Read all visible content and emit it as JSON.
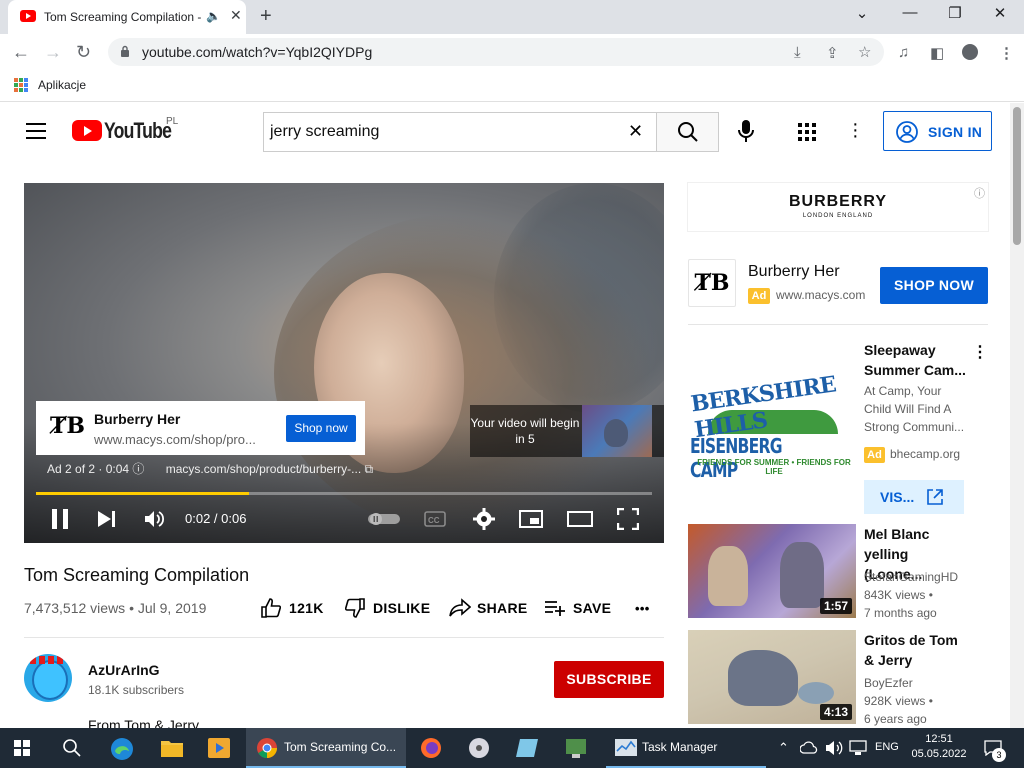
{
  "browser": {
    "tab_title": "Tom Screaming Compilation - YouTube",
    "tab_close": "✕",
    "new_tab": "+",
    "url": "youtube.com/watch?v=YqbI2QIYDPg",
    "bookmark_label": "Aplikacje",
    "window_controls": {
      "minimize": "—",
      "maximize": "❐",
      "close": "✕",
      "tab_list": "⌄"
    }
  },
  "youtube": {
    "logo_text": "YouTube",
    "country_code": "PL",
    "search_query": "jerry screaming",
    "sign_in_label": "SIGN IN",
    "player": {
      "ad_card": {
        "logo": "ȾB",
        "title": "Burberry Her",
        "url": "www.macys.com/shop/pro...",
        "button": "Shop now"
      },
      "ad_info": {
        "counter": "Ad 2 of 2 · 0:04",
        "info_icon": "ⓘ",
        "url": "macys.com/shop/product/burberry-..."
      },
      "skip_text": "Your video will begin in 5",
      "progress_fraction": 0.345,
      "time": "0:02 / 0:06"
    },
    "video": {
      "title": "Tom Screaming Compilation",
      "meta": "7,473,512 views • Jul 9, 2019",
      "likes": "121K",
      "dislike_label": "DISLIKE",
      "share_label": "SHARE",
      "save_label": "SAVE",
      "more": "•••"
    },
    "channel": {
      "name": "AzUrArInG",
      "subscribers": "18.1K subscribers",
      "subscribe_label": "SUBSCRIBE",
      "description_preview": "From Tom & Jerry"
    },
    "sidebar": {
      "banner": {
        "brand": "BURBERRY",
        "subline": "LONDON ENGLAND",
        "info": "ⓘ"
      },
      "ad": {
        "logo": "ȾB",
        "title": "Burberry Her",
        "badge": "Ad",
        "url": "www.macys.com",
        "button": "SHOP NOW"
      },
      "promo": {
        "thumb_line1": "BERKSHIRE HILLS",
        "thumb_line2": "EISENBERG CAMP",
        "thumb_tagline": "FRIENDS FOR SUMMER • FRIENDS FOR LIFE",
        "title": "Sleepaway Summer Cam...",
        "description": "At Camp, Your Child Will Find A Strong Communi...",
        "badge": "Ad",
        "domain": "bhecamp.org",
        "visit_label": "VIS..."
      },
      "videos": [
        {
          "title": "Mel Blanc yelling (Loone...",
          "channel": "StefanGamingHD",
          "views": "843K views •",
          "age": "7 months ago",
          "duration": "1:57"
        },
        {
          "title": "Gritos de Tom & Jerry",
          "channel": "BoyEzfer",
          "views": "928K views •",
          "age": "6 years ago",
          "duration": "4:13"
        }
      ]
    }
  },
  "taskbar": {
    "active_window": "Tom Screaming Co...",
    "task_manager": "Task Manager",
    "language": "ENG",
    "time": "12:51",
    "date": "05.05.2022",
    "notification_count": "3"
  },
  "colors": {
    "youtube_red": "#ff0000",
    "link_blue": "#065fd4",
    "subscribe_red": "#cc0000",
    "ad_yellow": "#fbc02d",
    "progress_yellow": "#ffcc00"
  }
}
